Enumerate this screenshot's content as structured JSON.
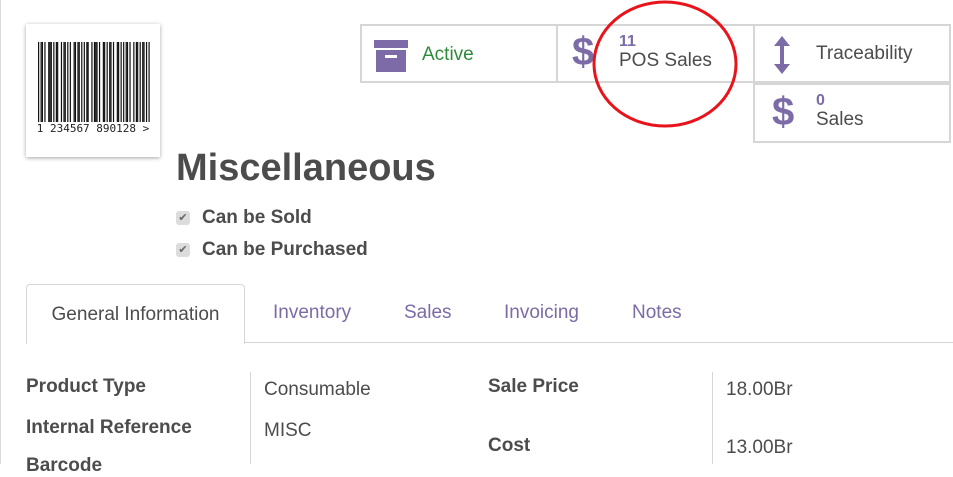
{
  "barcode": {
    "number": "1  234567  890128  >"
  },
  "stats": {
    "active": {
      "label": "Active",
      "icon": "archive-icon"
    },
    "pos_sales": {
      "count": "11",
      "label": "POS Sales",
      "icon": "dollar-icon"
    },
    "traceability": {
      "label": "Traceability",
      "icon": "vertical-arrows-icon"
    },
    "sales": {
      "count": "0",
      "label": "Sales",
      "icon": "dollar-icon"
    }
  },
  "product": {
    "name": "Miscellaneous",
    "can_be_sold": "Can be Sold",
    "can_be_purchased": "Can be Purchased"
  },
  "tabs": [
    {
      "label": "General Information"
    },
    {
      "label": "Inventory"
    },
    {
      "label": "Sales"
    },
    {
      "label": "Invoicing"
    },
    {
      "label": "Notes"
    }
  ],
  "fields": {
    "product_type": {
      "label": "Product Type",
      "value": "Consumable"
    },
    "internal_reference": {
      "label": "Internal Reference",
      "value": "MISC"
    },
    "barcode_label": "Barcode",
    "sale_price": {
      "label": "Sale Price",
      "value": "18.00Br"
    },
    "cost": {
      "label": "Cost",
      "value": "13.00Br"
    }
  },
  "colors": {
    "accent": "#7c6ba6",
    "active": "#2e8b3a",
    "annotation": "#e8141c"
  }
}
